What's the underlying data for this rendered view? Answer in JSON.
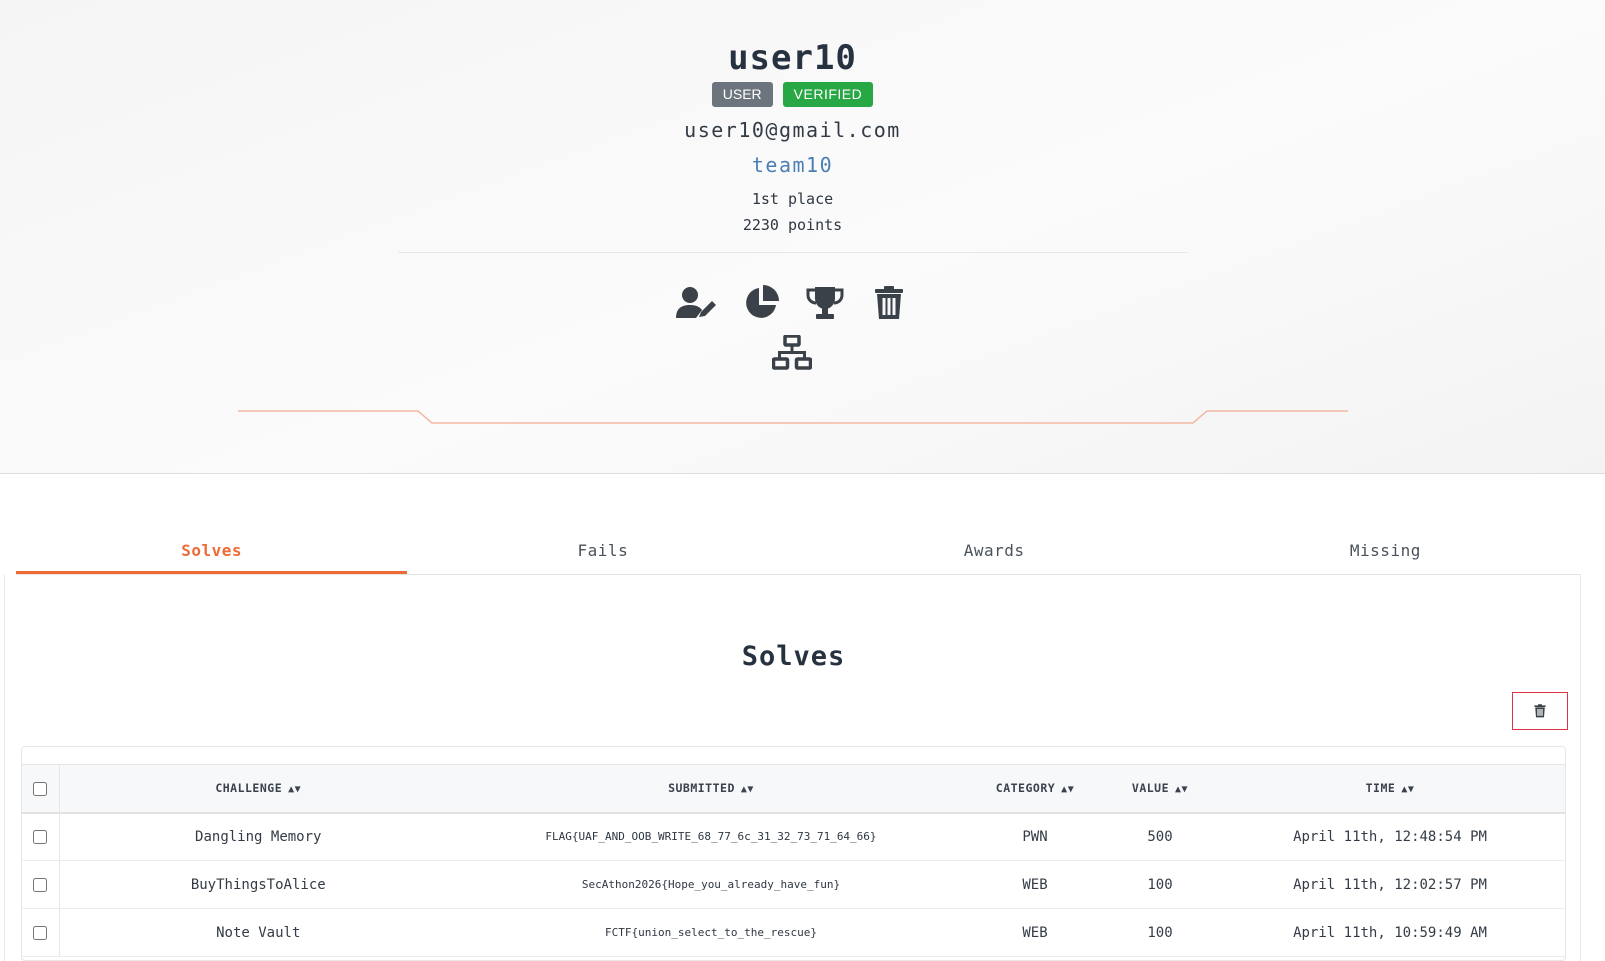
{
  "profile": {
    "username": "user10",
    "badge_user": "USER",
    "badge_verified": "VERIFIED",
    "email": "user10@gmail.com",
    "team": "team10",
    "place": "1st place",
    "points": "2230 points"
  },
  "action_icons": [
    "user-edit-icon",
    "pie-chart-icon",
    "trophy-icon",
    "trash-icon",
    "network-icon"
  ],
  "tabs": [
    {
      "label": "Solves",
      "active": true
    },
    {
      "label": "Fails",
      "active": false
    },
    {
      "label": "Awards",
      "active": false
    },
    {
      "label": "Missing",
      "active": false
    }
  ],
  "section_title": "Solves",
  "table": {
    "headers": [
      "CHALLENGE",
      "SUBMITTED",
      "CATEGORY",
      "VALUE",
      "TIME"
    ],
    "rows": [
      [
        "Dangling Memory",
        "FLAG{UAF_AND_OOB_WRITE_68_77_6c_31_32_73_71_64_66}",
        "PWN",
        "500",
        "April 11th, 12:48:54 PM"
      ],
      [
        "BuyThingsToAlice",
        "SecAthon2026{Hope_you_already_have_fun}",
        "WEB",
        "100",
        "April 11th, 12:02:57 PM"
      ],
      [
        "Note Vault",
        "FCTF{union_select_to_the_rescue}",
        "WEB",
        "100",
        "April 11th, 10:59:49 AM"
      ]
    ]
  },
  "colors": {
    "accent": "#ef6b35",
    "verified": "#28a745",
    "user_badge": "#6c757d",
    "link": "#4b7fb5",
    "danger": "#dc3545"
  }
}
